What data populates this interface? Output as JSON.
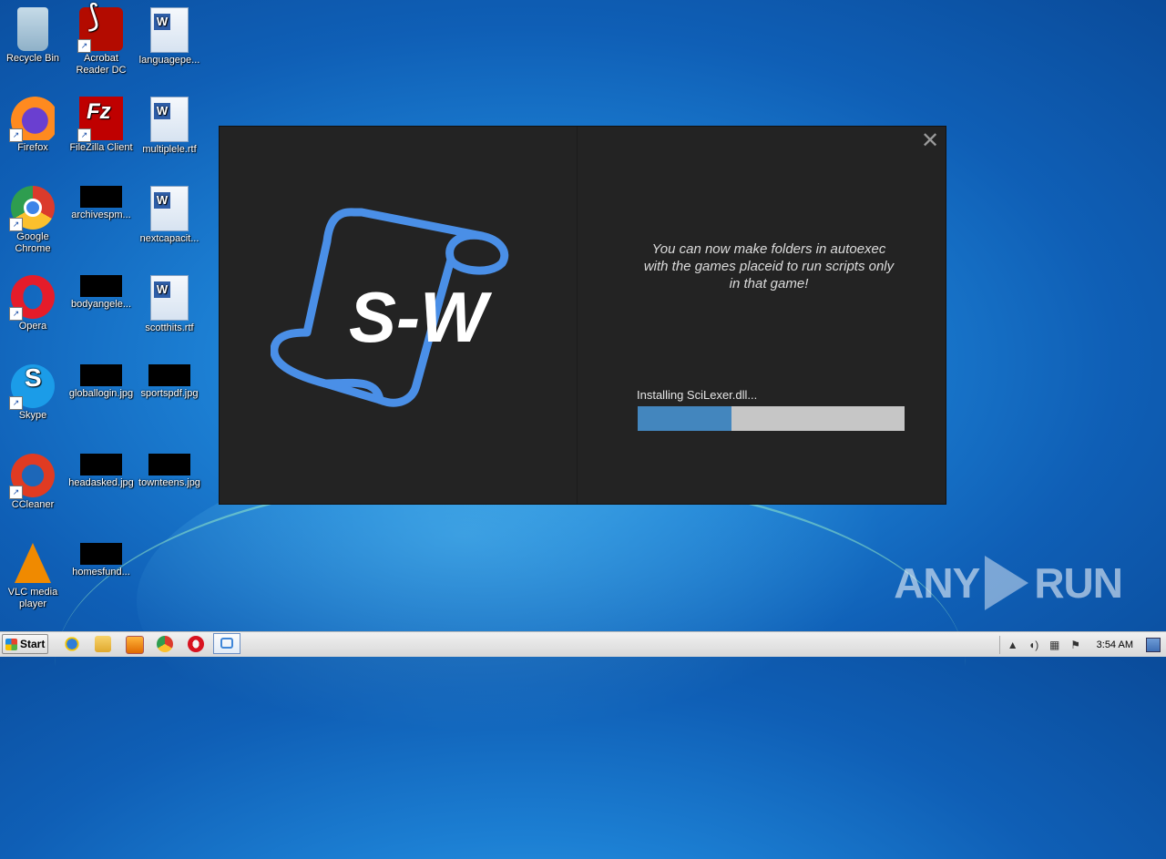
{
  "desktop": {
    "icons": [
      {
        "label": "Recycle Bin",
        "icon": "recycle-bin-icon"
      },
      {
        "label": "Acrobat Reader DC",
        "icon": "acrobat-icon"
      },
      {
        "label": "languagepe...",
        "icon": "word-document-icon"
      },
      {
        "label": "Firefox",
        "icon": "firefox-icon"
      },
      {
        "label": "FileZilla Client",
        "icon": "filezilla-icon"
      },
      {
        "label": "multiplele.rtf",
        "icon": "word-document-icon"
      },
      {
        "label": "Google Chrome",
        "icon": "chrome-icon"
      },
      {
        "label": "archivespm...",
        "icon": "image-thumbnail-icon"
      },
      {
        "label": "nextcapacit...",
        "icon": "word-document-icon"
      },
      {
        "label": "Opera",
        "icon": "opera-icon"
      },
      {
        "label": "bodyangele...",
        "icon": "image-thumbnail-icon"
      },
      {
        "label": "scotthits.rtf",
        "icon": "word-document-icon"
      },
      {
        "label": "Skype",
        "icon": "skype-icon"
      },
      {
        "label": "globallogin.jpg",
        "icon": "image-thumbnail-icon"
      },
      {
        "label": "sportspdf.jpg",
        "icon": "image-thumbnail-icon"
      },
      {
        "label": "CCleaner",
        "icon": "ccleaner-icon"
      },
      {
        "label": "headasked.jpg",
        "icon": "image-thumbnail-icon"
      },
      {
        "label": "townteens.jpg",
        "icon": "image-thumbnail-icon"
      },
      {
        "label": "VLC media player",
        "icon": "vlc-icon"
      },
      {
        "label": "homesfund...",
        "icon": "image-thumbnail-icon"
      }
    ]
  },
  "installer": {
    "logo_text": "S-W",
    "tip": "You can now make folders in autoexec with the games placeid to run scripts only in that game!",
    "status": "Installing SciLexer.dll...",
    "progress": 0.35,
    "close_icon": "close-icon",
    "accent": "#4a8fe7"
  },
  "watermark": {
    "text_left": "ANY",
    "text_right": "RUN"
  },
  "taskbar": {
    "start_label": "Start",
    "clock": "3:54 AM",
    "pinned": [
      "internet-explorer-icon",
      "explorer-folder-icon",
      "media-player-icon",
      "chrome-icon",
      "opera-icon"
    ],
    "active_app": "installer-icon"
  }
}
